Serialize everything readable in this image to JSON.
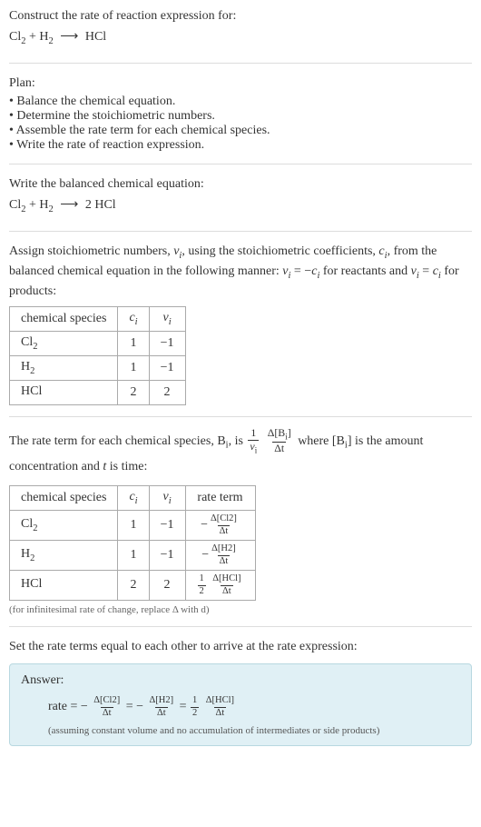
{
  "header": {
    "prompt": "Construct the rate of reaction expression for:",
    "equation_lhs1": "Cl",
    "equation_lhs1_sub": "2",
    "equation_plus": " + ",
    "equation_lhs2": "H",
    "equation_lhs2_sub": "2",
    "equation_arrow": "⟶",
    "equation_rhs": " HCl"
  },
  "plan": {
    "title": "Plan:",
    "items": [
      "Balance the chemical equation.",
      "Determine the stoichiometric numbers.",
      "Assemble the rate term for each chemical species.",
      "Write the rate of reaction expression."
    ]
  },
  "balanced": {
    "title": "Write the balanced chemical equation:",
    "lhs1": "Cl",
    "lhs1_sub": "2",
    "plus": " + ",
    "lhs2": "H",
    "lhs2_sub": "2",
    "arrow": "⟶",
    "rhs_coef": " 2 ",
    "rhs": "HCl"
  },
  "stoich_assign": {
    "text_part1": "Assign stoichiometric numbers, ",
    "nu_i": "ν",
    "nu_i_sub": "i",
    "text_part2": ", using the stoichiometric coefficients, ",
    "c_i": "c",
    "c_i_sub": "i",
    "text_part3": ", from the balanced chemical equation in the following manner: ",
    "rel1_a": "ν",
    "rel1_sub": "i",
    "rel1_eq": " = −",
    "rel1_b": "c",
    "rel1_bsub": "i",
    "text_part4": " for reactants and ",
    "rel2_a": "ν",
    "rel2_sub": "i",
    "rel2_eq": " = ",
    "rel2_b": "c",
    "rel2_bsub": "i",
    "text_part5": " for products:",
    "table": {
      "headers": {
        "species": "chemical species",
        "ci": "c",
        "ci_sub": "i",
        "nui": "ν",
        "nui_sub": "i"
      },
      "rows": [
        {
          "sp": "Cl",
          "sp_sub": "2",
          "ci": "1",
          "nui": "−1"
        },
        {
          "sp": "H",
          "sp_sub": "2",
          "ci": "1",
          "nui": "−1"
        },
        {
          "sp": "HCl",
          "sp_sub": "",
          "ci": "2",
          "nui": "2"
        }
      ]
    }
  },
  "rate_term": {
    "text_part1": "The rate term for each chemical species, B",
    "b_sub": "i",
    "text_part2": ", is ",
    "frac1_num": "1",
    "frac1_den_a": "ν",
    "frac1_den_sub": "i",
    "frac2_num": "Δ[B",
    "frac2_num_sub": "i",
    "frac2_num_end": "]",
    "frac2_den": "Δt",
    "text_part3": " where [B",
    "text_part3_sub": "i",
    "text_part4": "] is the amount concentration and ",
    "t_ital": "t",
    "text_part5": " is time:",
    "table": {
      "headers": {
        "species": "chemical species",
        "ci": "c",
        "ci_sub": "i",
        "nui": "ν",
        "nui_sub": "i",
        "rate": "rate term"
      },
      "rows": [
        {
          "sp": "Cl",
          "sp_sub": "2",
          "ci": "1",
          "nui": "−1",
          "rate_top": "Δ[Cl2]",
          "rate_bot": "Δt",
          "prefix": "−"
        },
        {
          "sp": "H",
          "sp_sub": "2",
          "ci": "1",
          "nui": "−1",
          "rate_top": "Δ[H2]",
          "rate_bot": "Δt",
          "prefix": "−"
        },
        {
          "sp": "HCl",
          "sp_sub": "",
          "ci": "2",
          "nui": "2",
          "rate_top": "Δ[HCl]",
          "rate_bot": "Δt",
          "prefix": "",
          "half_num": "1",
          "half_den": "2"
        }
      ]
    },
    "caption": "(for infinitesimal rate of change, replace Δ with d)"
  },
  "final": {
    "title": "Set the rate terms equal to each other to arrive at the rate expression:",
    "answer_label": "Answer:",
    "rate_word": "rate = −",
    "t1_num": "Δ[Cl2]",
    "t1_den": "Δt",
    "eq1": " = −",
    "t2_num": "Δ[H2]",
    "t2_den": "Δt",
    "eq2": " = ",
    "half_num": "1",
    "half_den": "2",
    "t3_num": "Δ[HCl]",
    "t3_den": "Δt",
    "caption": "(assuming constant volume and no accumulation of intermediates or side products)"
  }
}
